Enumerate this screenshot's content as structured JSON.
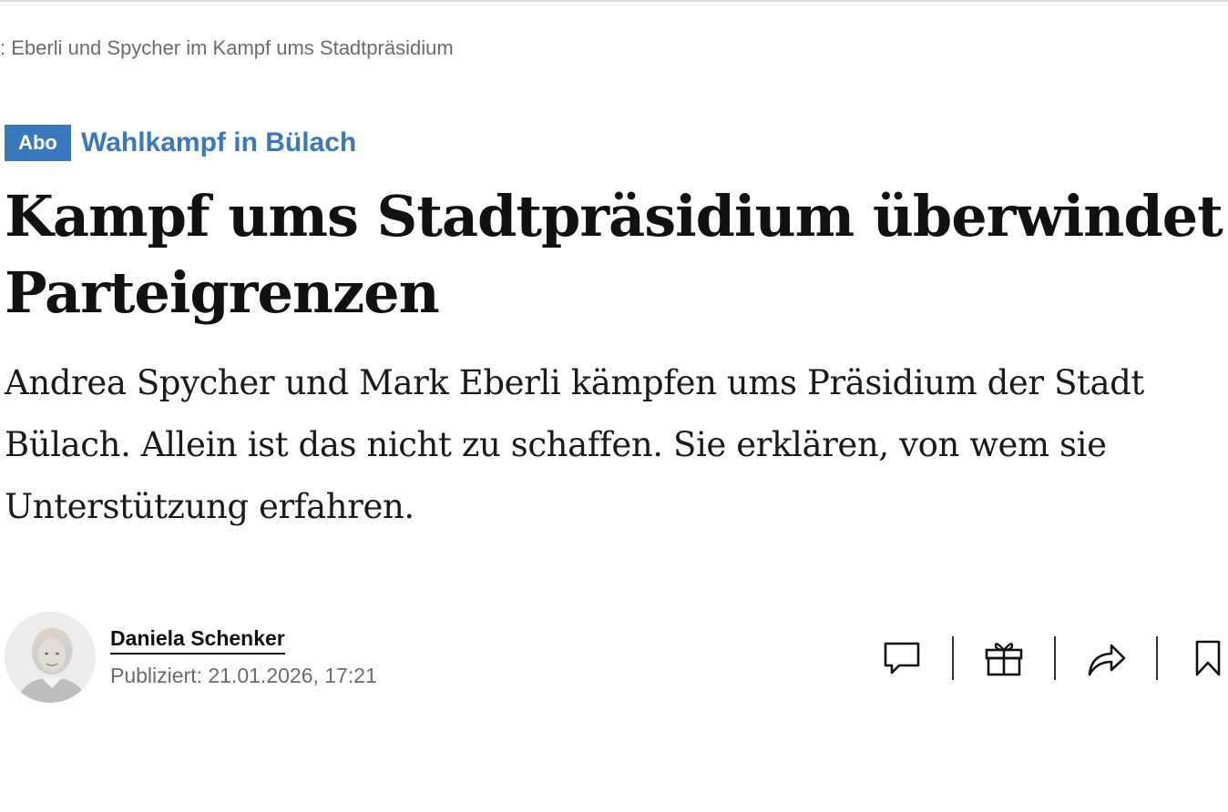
{
  "ticker": {
    "text": ": Eberli und Spycher im Kampf ums Stadtpräsidium"
  },
  "kicker": {
    "badge": "Abo",
    "topic": "Wahlkampf in Bülach",
    "accent_color": "#3a78bd"
  },
  "article": {
    "headline": "Kampf ums Stadtpräsidium überwindet Parteigrenzen",
    "lead": "Andrea Spycher und Mark Eberli kämpfen ums Präsidium der Stadt Bülach. Allein ist das nicht zu schaffen. Sie erklären, von wem sie Unterstützung erfahren."
  },
  "byline": {
    "author": "Daniela Schenker",
    "published": "Publiziert: 21.01.2026, 17:21"
  },
  "actions": [
    {
      "icon": "comment-icon"
    },
    {
      "icon": "gift-icon"
    },
    {
      "icon": "share-icon"
    },
    {
      "icon": "bookmark-icon"
    }
  ]
}
